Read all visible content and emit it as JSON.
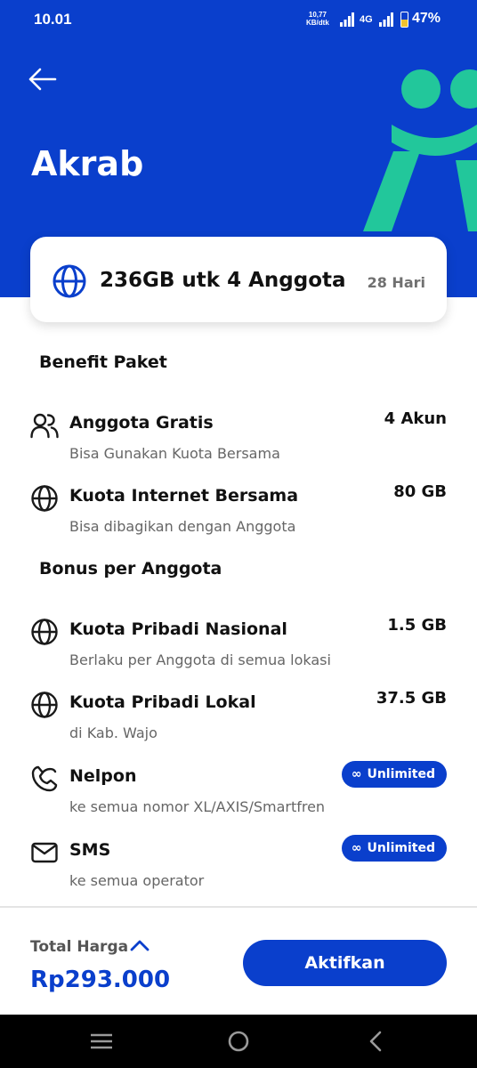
{
  "status_bar": {
    "time": "10.01",
    "speed_value": "10,77",
    "speed_unit": "KB/dtk",
    "network": "4G",
    "battery_percent": "47%",
    "battery_level": 0.47
  },
  "header": {
    "title": "Akrab",
    "back_icon": "arrow-left-icon",
    "logo": "akrab-logo"
  },
  "package": {
    "icon": "globe-icon",
    "name": "236GB utk 4 Anggota",
    "duration": "28 Hari"
  },
  "benefit_section": {
    "title": "Benefit Paket",
    "items": [
      {
        "icon": "users-icon",
        "label": "Anggota Gratis",
        "sub": "Bisa Gunakan Kuota Bersama",
        "value": "4 Akun"
      },
      {
        "icon": "globe-icon",
        "label": "Kuota Internet Bersama",
        "sub": "Bisa dibagikan dengan Anggota",
        "value": "80 GB"
      }
    ]
  },
  "bonus_section": {
    "title": "Bonus per Anggota",
    "items": [
      {
        "icon": "globe-icon",
        "label": "Kuota Pribadi Nasional",
        "sub": "Berlaku per Anggota di semua lokasi",
        "value": "1.5 GB"
      },
      {
        "icon": "globe-icon",
        "label": "Kuota Pribadi Lokal",
        "sub": "di Kab. Wajo",
        "value": "37.5 GB"
      },
      {
        "icon": "phone-icon",
        "label": "Nelpon",
        "sub": "ke semua nomor XL/AXIS/Smartfren",
        "badge_symbol": "∞",
        "badge": "Unlimited"
      },
      {
        "icon": "mail-icon",
        "label": "SMS",
        "sub": "ke semua operator",
        "badge_symbol": "∞",
        "badge": "Unlimited"
      }
    ]
  },
  "footer": {
    "total_label": "Total Harga",
    "total_price": "Rp293.000",
    "activate_label": "Aktifkan"
  },
  "colors": {
    "brand_blue": "#0a3fcc",
    "logo_green": "#22c79b"
  }
}
